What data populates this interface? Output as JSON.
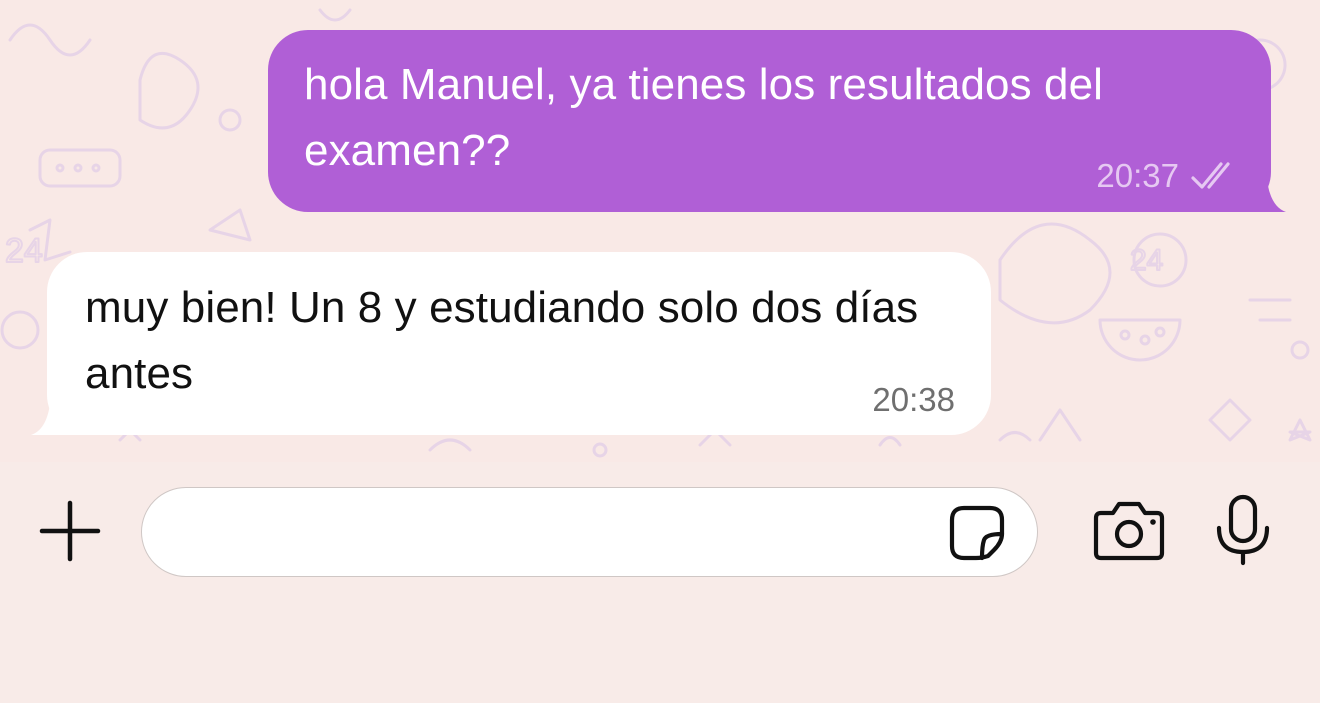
{
  "chat": {
    "messages": [
      {
        "direction": "outgoing",
        "text": "hola Manuel, ya tienes los resultados del examen??",
        "time": "20:37",
        "status_icon": "double-check-icon"
      },
      {
        "direction": "incoming",
        "text": "muy bien! Un 8 y estudiando solo dos días antes",
        "time": "20:38"
      }
    ]
  },
  "composer": {
    "input_value": "",
    "icons": {
      "attach": "plus-icon",
      "sticker": "sticker-icon",
      "camera": "camera-icon",
      "mic": "microphone-icon"
    }
  },
  "colors": {
    "outgoing_bubble": "#b05fd6",
    "incoming_bubble": "#ffffff",
    "chat_background": "#f9e9e6",
    "composer_background": "#f8ebe8"
  }
}
